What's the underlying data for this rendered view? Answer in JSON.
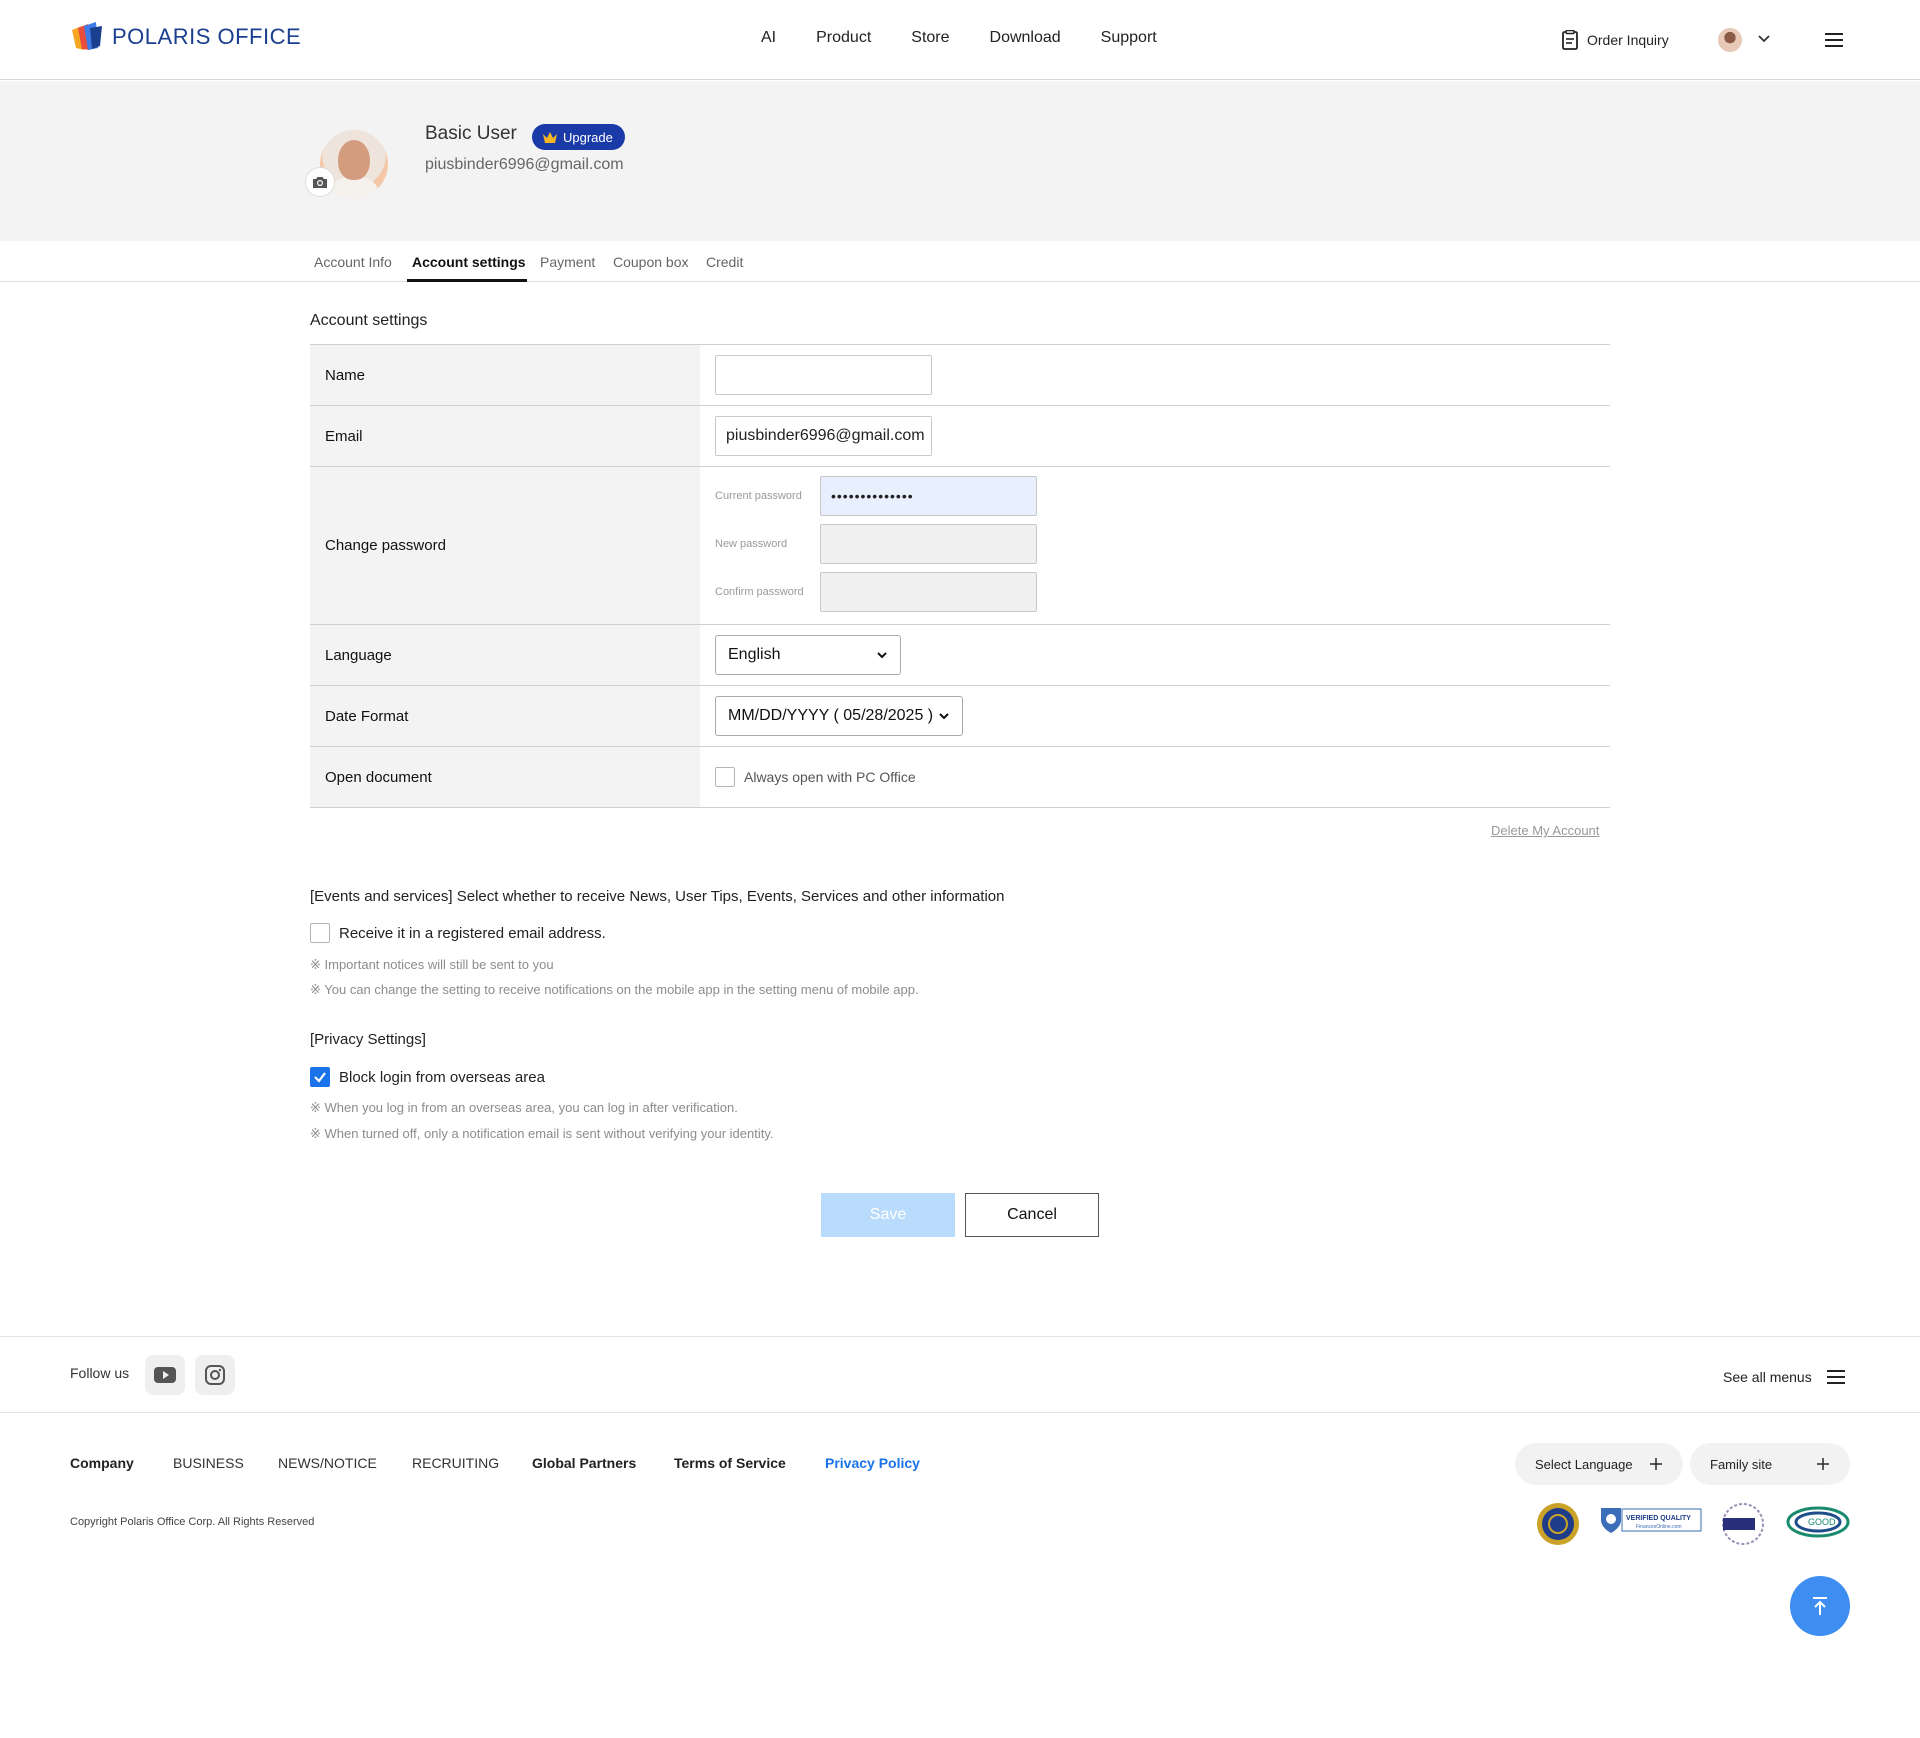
{
  "header": {
    "logo_text": "POLARIS OFFICE",
    "nav": [
      "AI",
      "Product",
      "Store",
      "Download",
      "Support"
    ],
    "order_inquiry": "Order Inquiry"
  },
  "profile": {
    "name": "Basic User",
    "upgrade_label": "Upgrade",
    "email": "piusbinder6996@gmail.com"
  },
  "tabs": [
    {
      "label": "Account Info",
      "active": false
    },
    {
      "label": "Account settings",
      "active": true
    },
    {
      "label": "Payment",
      "active": false
    },
    {
      "label": "Coupon box",
      "active": false
    },
    {
      "label": "Credit",
      "active": false
    }
  ],
  "account_settings": {
    "title": "Account settings",
    "name_label": "Name",
    "name_value": "",
    "email_label": "Email",
    "email_value": "piusbinder6996@gmail.com",
    "password_label": "Change password",
    "current_password_label": "Current password",
    "current_password_value": "••••••••••••••",
    "new_password_label": "New password",
    "confirm_password_label": "Confirm password",
    "language_label": "Language",
    "language_value": "English",
    "date_format_label": "Date Format",
    "date_format_value": "MM/DD/YYYY ( 05/28/2025 )",
    "open_document_label": "Open document",
    "open_document_option": "Always open with PC Office",
    "open_document_checked": false,
    "delete_account": "Delete My Account"
  },
  "events": {
    "title": "[Events and services] Select whether to receive News, User Tips, Events, Services and other information",
    "option": "Receive it in a registered email address.",
    "checked": false,
    "notes": [
      "※ Important notices will still be sent to you",
      "※ You can change the setting to receive notifications on the mobile app in the setting menu of mobile app."
    ]
  },
  "privacy": {
    "title": "[Privacy Settings]",
    "option": "Block login from overseas area",
    "checked": true,
    "notes": [
      "※ When you log in from an overseas area, you can log in after verification.",
      "※ When turned off, only a notification email is sent without verifying your identity."
    ]
  },
  "actions": {
    "save": "Save",
    "cancel": "Cancel"
  },
  "footer": {
    "follow_us": "Follow us",
    "see_all_menus": "See all menus",
    "links": [
      "Company",
      "BUSINESS",
      "NEWS/NOTICE",
      "RECRUITING",
      "Global Partners",
      "Terms of Service",
      "Privacy Policy"
    ],
    "select_language": "Select Language",
    "family_site": "Family site",
    "copyright": "Copyright Polaris Office Corp. All Rights Reserved",
    "badge_verified_quality": "VERIFIED QUALITY",
    "badge_verified_source": "FinancesOnline.com",
    "badge_good": "GOOD"
  },
  "colors": {
    "brand_blue": "#1a3f8f",
    "upgrade_bg": "#1a3aa8",
    "accent": "#1a73e8",
    "save_disabled": "#b9dcfc",
    "to_top": "#3d8ef0"
  }
}
